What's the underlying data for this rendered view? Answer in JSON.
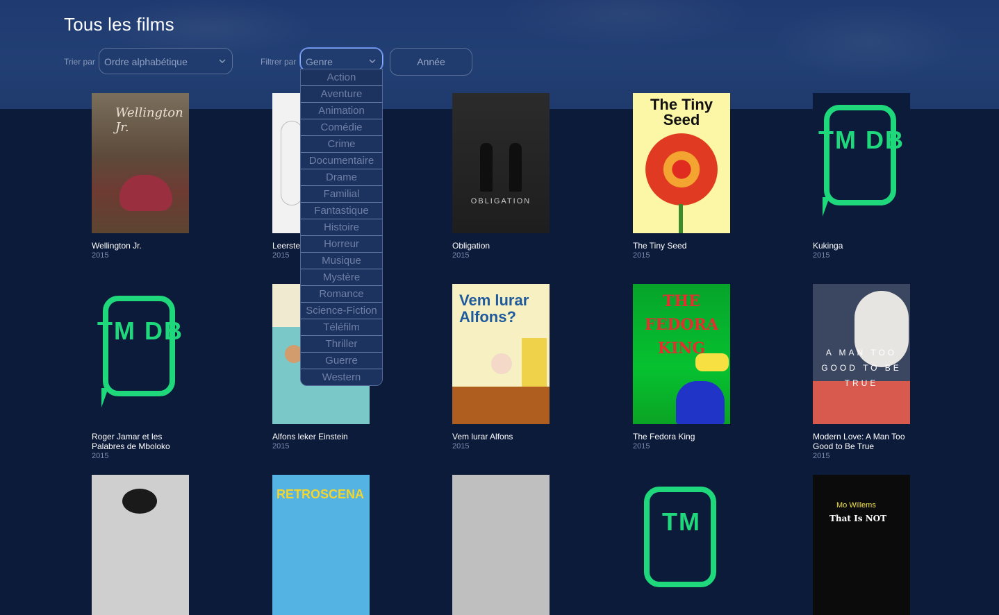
{
  "page": {
    "title": "Tous les films"
  },
  "controls": {
    "sort_label": "Trier par",
    "sort_value": "Ordre alphabétique",
    "filter_label": "Filtrer par",
    "genre_value": "Genre",
    "year_button": "Année",
    "genre_options": [
      "Action",
      "Aventure",
      "Animation",
      "Comédie",
      "Crime",
      "Documentaire",
      "Drame",
      "Familial",
      "Fantastique",
      "Histoire",
      "Horreur",
      "Musique",
      "Mystère",
      "Romance",
      "Science-Fiction",
      "Téléfilm",
      "Thriller",
      "Guerre",
      "Western"
    ]
  },
  "movies": [
    {
      "title": "Wellington Jr.",
      "year": "2015",
      "poster_text": "Wellington Jr."
    },
    {
      "title": "Leerste",
      "year": "2015"
    },
    {
      "title": "Obligation",
      "year": "2015",
      "poster_text": "OBLIGATION"
    },
    {
      "title": "The Tiny Seed",
      "year": "2015",
      "poster_text": "The Tiny Seed"
    },
    {
      "title": "Kukinga",
      "year": "2015",
      "poster_text": "TM DB"
    },
    {
      "title": "Roger Jamar et les Palabres de Mboloko",
      "year": "2015",
      "poster_text": "TM DB"
    },
    {
      "title": "Alfons leker Einstein",
      "year": "2015"
    },
    {
      "title": "Vem lurar Alfons",
      "year": "2015",
      "poster_text": "Vem lurar Alfons?"
    },
    {
      "title": "The Fedora King",
      "year": "2015",
      "poster_text": "THE FEDORA KING"
    },
    {
      "title": "Modern Love: A Man Too Good to Be True",
      "year": "2015",
      "poster_text": "A MAN TOO GOOD TO BE TRUE"
    },
    {
      "title": "",
      "year": ""
    },
    {
      "title": "",
      "year": "",
      "poster_text": "RETROSCENA"
    },
    {
      "title": "",
      "year": ""
    },
    {
      "title": "",
      "year": "",
      "poster_text": "TM"
    },
    {
      "title": "",
      "year": "",
      "poster_text": "That Is NOT",
      "poster_sub": "Mo Willems"
    }
  ],
  "colors": {
    "background": "#0d1b3a",
    "hero": "#223f74",
    "tmdb_green": "#1ed87b",
    "year_text": "#7e8ab0"
  },
  "icons": {
    "select_chevron": "chevron-down-icon"
  }
}
